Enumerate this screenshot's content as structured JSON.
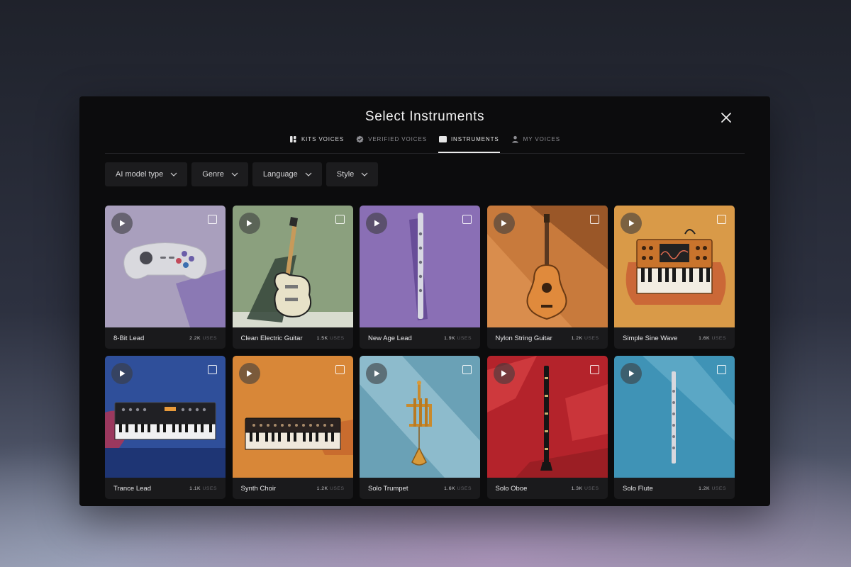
{
  "modal": {
    "title": "Select Instruments"
  },
  "tabs": [
    {
      "label": "KITS VOICES",
      "icon": "kits-icon",
      "active": false
    },
    {
      "label": "VERIFIED VOICES",
      "icon": "verified-badge-icon",
      "active": false
    },
    {
      "label": "INSTRUMENTS",
      "icon": "piano-keys-icon",
      "active": true
    },
    {
      "label": "MY VOICES",
      "icon": "user-icon",
      "active": false
    }
  ],
  "filters": [
    {
      "label": "AI model type"
    },
    {
      "label": "Genre"
    },
    {
      "label": "Language"
    },
    {
      "label": "Style"
    }
  ],
  "instruments": [
    {
      "name": "8-Bit Lead",
      "uses": "2.2K",
      "uses_label": "USES",
      "image": "game-controller",
      "bg": "#a99fbd"
    },
    {
      "name": "Clean Electric Guitar",
      "uses": "1.5K",
      "uses_label": "USES",
      "image": "electric-guitar",
      "bg": "#8ba07e"
    },
    {
      "name": "New Age Lead",
      "uses": "1.9K",
      "uses_label": "USES",
      "image": "flute",
      "bg": "#8a6fb5"
    },
    {
      "name": "Nylon String Guitar",
      "uses": "1.2K",
      "uses_label": "USES",
      "image": "acoustic-guitar",
      "bg": "#c87a3c"
    },
    {
      "name": "Simple Sine Wave",
      "uses": "1.6K",
      "uses_label": "USES",
      "image": "synthesizer",
      "bg": "#d99a48"
    },
    {
      "name": "Trance Lead",
      "uses": "1.1K",
      "uses_label": "USES",
      "image": "keyboard-synth",
      "bg": "#2f4f9a"
    },
    {
      "name": "Synth Choir",
      "uses": "1.2K",
      "uses_label": "USES",
      "image": "keyboard",
      "bg": "#d88738"
    },
    {
      "name": "Solo Trumpet",
      "uses": "1.6K",
      "uses_label": "USES",
      "image": "trumpet",
      "bg": "#6aa1b6"
    },
    {
      "name": "Solo Oboe",
      "uses": "1.3K",
      "uses_label": "USES",
      "image": "oboe",
      "bg": "#b4232b"
    },
    {
      "name": "Solo Flute",
      "uses": "1.2K",
      "uses_label": "USES",
      "image": "flute",
      "bg": "#3f93b6"
    }
  ]
}
